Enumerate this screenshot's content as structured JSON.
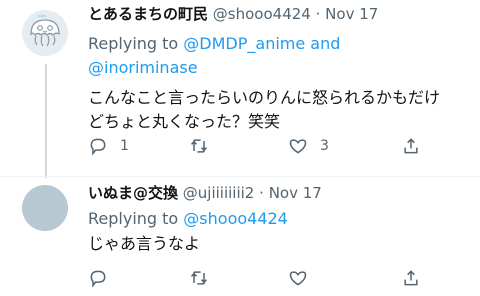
{
  "tweets": [
    {
      "display_name": "とあるまちの町民",
      "handle": "@shooo4424",
      "separator": "·",
      "date": "Nov 17",
      "replying_prefix": "Replying to ",
      "replying_users": "@DMDP_anime and @inoriminase",
      "text": "こんなこと言ったらいのりんに怒られるかもだけどちょと丸くなった？笑笑",
      "reply_count": "1",
      "retweet_count": "",
      "like_count": "3",
      "avatar_icon": "jellyfish-avatar-icon"
    },
    {
      "display_name": "いぬま@交換",
      "handle": "@ujiiiiiiii2",
      "separator": "·",
      "date": "Nov 17",
      "replying_prefix": "Replying to ",
      "replying_users": "@shooo4424",
      "text": "じゃあ言うなよ",
      "reply_count": "",
      "retweet_count": "",
      "like_count": "",
      "avatar_icon": "default-avatar-icon"
    }
  ],
  "colors": {
    "link": "#1d9bf0",
    "muted": "#536471",
    "text": "#0f1419",
    "thread_line": "#cfd9de"
  }
}
